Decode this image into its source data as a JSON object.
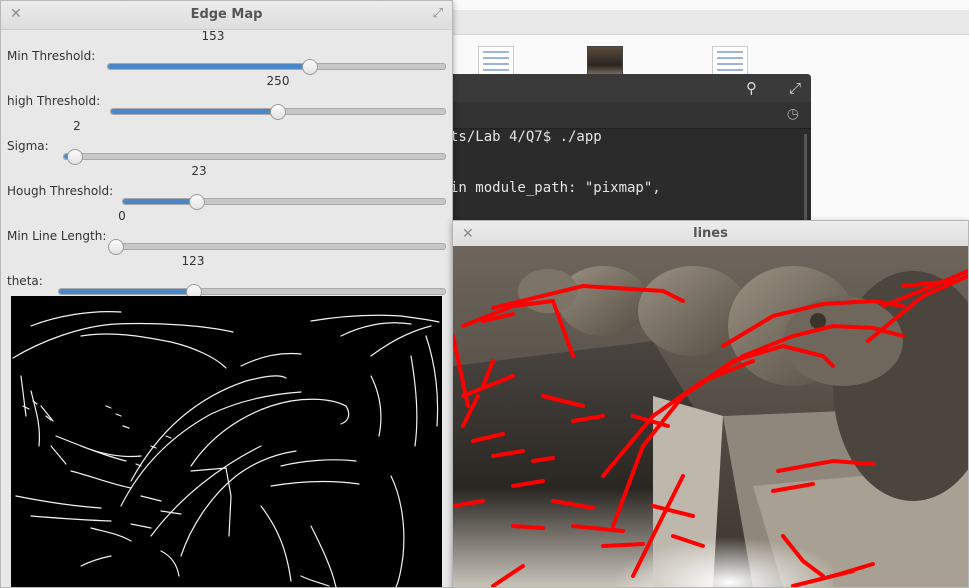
{
  "edge_map": {
    "title": "Edge Map",
    "sliders": [
      {
        "label": "Min Threshold:",
        "value": "153",
        "level": 0.6
      },
      {
        "label": "high Threshold:",
        "value": "250",
        "level": 0.5
      },
      {
        "label": "Sigma:",
        "value": "2",
        "level": 0.03
      },
      {
        "label": "Hough Threshold:",
        "value": "23",
        "level": 0.23
      },
      {
        "label": "Min Line Length:",
        "value": "0",
        "level": 0.0
      },
      {
        "label": "theta:",
        "value": "123",
        "level": 0.35
      }
    ]
  },
  "terminal": {
    "line1": "ts/Lab 4/Q7$ ./app",
    "line2": "in module_path: \"pixmap\","
  },
  "lines_window": {
    "title": "lines"
  },
  "colors": {
    "slider_fill": "#4a86c8",
    "overlay_lines": "#ff0000"
  },
  "icons": [
    "close-icon",
    "maximize-icon",
    "search-icon",
    "history-icon"
  ]
}
